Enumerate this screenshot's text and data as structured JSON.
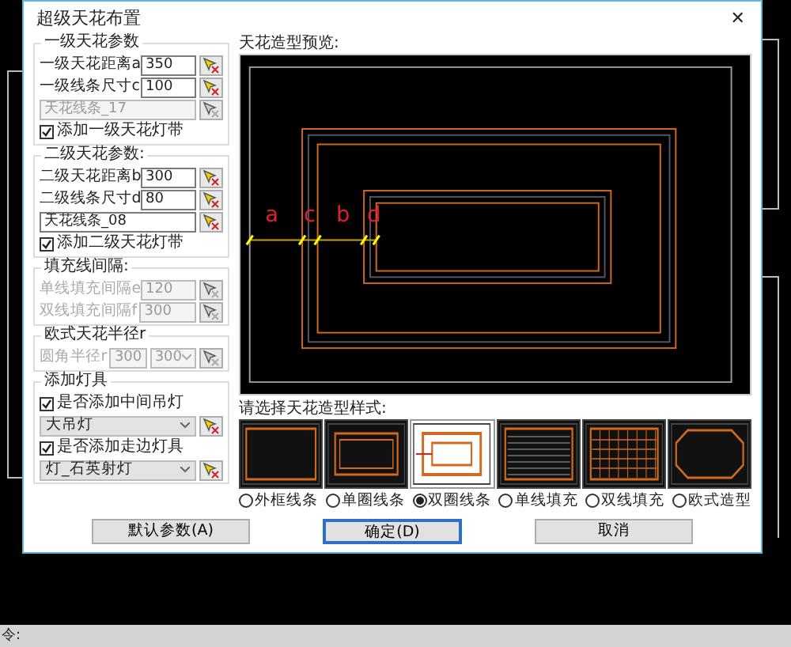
{
  "dialog": {
    "title": "超级天花布置",
    "close": "✕"
  },
  "groups": [
    {
      "title": "一级天花参数",
      "rows": [
        {
          "kind": "labeled",
          "label": "一级天花距离a",
          "value": "350",
          "disabled": false
        },
        {
          "kind": "labeled",
          "label": "一级线条尺寸c",
          "value": "100",
          "disabled": false
        },
        {
          "kind": "name",
          "value": "天花线条_17",
          "disabled": true
        },
        {
          "kind": "check",
          "label": "添加一级天花灯带",
          "checked": true
        }
      ]
    },
    {
      "title": "二级天花参数:",
      "rows": [
        {
          "kind": "labeled",
          "label": "二级天花距离b",
          "value": "300",
          "disabled": false
        },
        {
          "kind": "labeled",
          "label": "二级线条尺寸d",
          "value": "80",
          "disabled": false
        },
        {
          "kind": "name",
          "value": "天花线条_08",
          "disabled": false
        },
        {
          "kind": "check",
          "label": "添加二级天花灯带",
          "checked": true
        }
      ]
    },
    {
      "title": "填充线间隔:",
      "rows": [
        {
          "kind": "labeled",
          "label": "单线填充间隔e",
          "value": "120",
          "disabled": true
        },
        {
          "kind": "labeled",
          "label": "双线填充间隔f",
          "value": "300",
          "disabled": true
        }
      ]
    },
    {
      "title": "欧式天花半径r",
      "rows": [
        {
          "kind": "dual",
          "label": "圆角半径r",
          "value": "300",
          "select": "300",
          "disabled": true
        }
      ]
    },
    {
      "title": "添加灯具",
      "rows": [
        {
          "kind": "check",
          "label": "是否添加中间吊灯",
          "checked": true
        },
        {
          "kind": "select",
          "value": "大吊灯",
          "disabled": false
        },
        {
          "kind": "check",
          "label": "是否添加走边灯具",
          "checked": true
        },
        {
          "kind": "select",
          "value": "灯_石英射灯",
          "disabled": false
        }
      ]
    }
  ],
  "preview": {
    "title": "天花造型预览:",
    "labels": [
      "a",
      "c",
      "b",
      "d"
    ]
  },
  "styles": {
    "title": "请选择天花造型样式:",
    "items": [
      {
        "kind": "frame",
        "label": "外框线条",
        "selected": false
      },
      {
        "kind": "single",
        "label": "单圈线条",
        "selected": false
      },
      {
        "kind": "double",
        "label": "双圈线条",
        "selected": true
      },
      {
        "kind": "hfill",
        "label": "单线填充",
        "selected": false
      },
      {
        "kind": "grid",
        "label": "双线填充",
        "selected": false
      },
      {
        "kind": "euro",
        "label": "欧式造型",
        "selected": false
      }
    ]
  },
  "buttons": [
    {
      "label": "默认参数(A)",
      "default": false
    },
    {
      "label": "确定(D)",
      "default": true
    },
    {
      "label": "取消",
      "default": false
    }
  ],
  "command_line": "令:"
}
